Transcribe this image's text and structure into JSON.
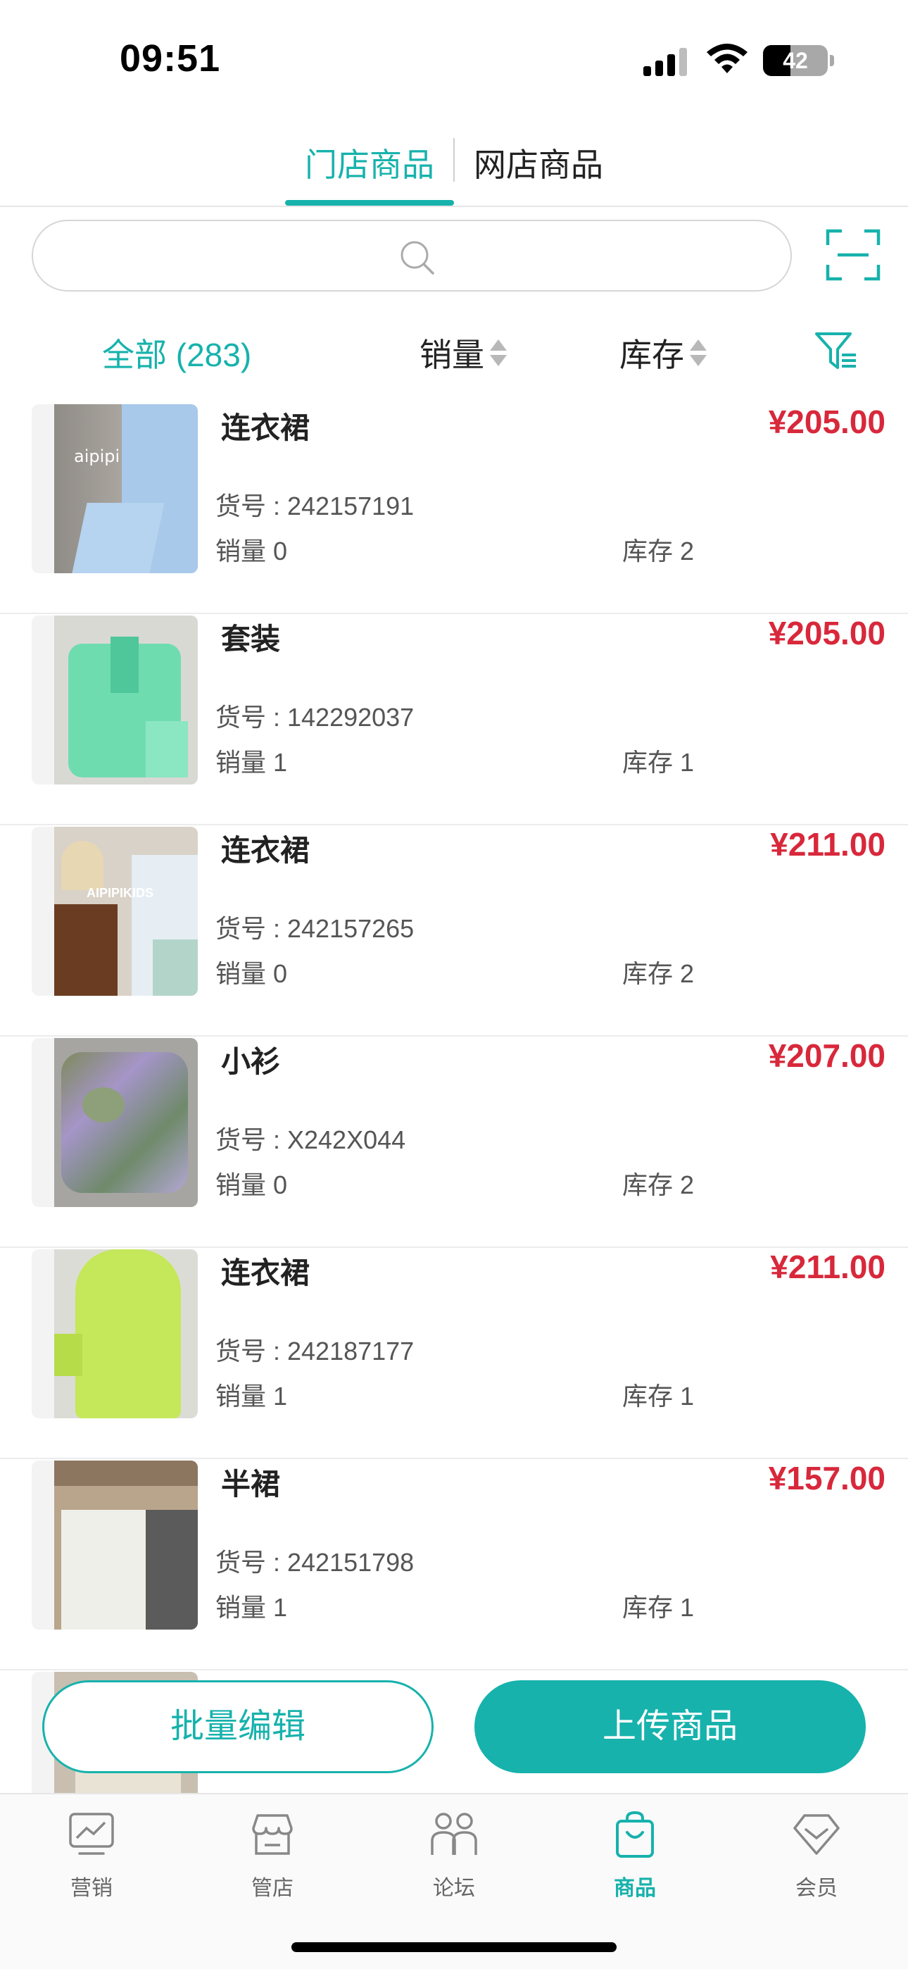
{
  "status_bar": {
    "time": "09:51",
    "battery": "42",
    "battery_level": 0.42
  },
  "tabs": [
    {
      "label": "门店商品",
      "active": true
    },
    {
      "label": "网店商品",
      "active": false
    }
  ],
  "search": {
    "placeholder": ""
  },
  "filter": {
    "all_label": "全部 (283)",
    "sales_label": "销量",
    "stock_label": "库存"
  },
  "products": [
    {
      "name": "连衣裙",
      "price": "¥205.00",
      "sku": "货号 : 242157191",
      "sales": "销量 0",
      "stock": "库存 2"
    },
    {
      "name": "套装",
      "price": "¥205.00",
      "sku": "货号 : 142292037",
      "sales": "销量 1",
      "stock": "库存 1"
    },
    {
      "name": "连衣裙",
      "price": "¥211.00",
      "sku": "货号 : 242157265",
      "sales": "销量 0",
      "stock": "库存 2"
    },
    {
      "name": "小衫",
      "price": "¥207.00",
      "sku": "货号 : X242X044",
      "sales": "销量 0",
      "stock": "库存 2"
    },
    {
      "name": "连衣裙",
      "price": "¥211.00",
      "sku": "货号 : 242187177",
      "sales": "销量 1",
      "stock": "库存 1"
    },
    {
      "name": "半裙",
      "price": "¥157.00",
      "sku": "货号 : 242151798",
      "sales": "销量 1",
      "stock": "库存 1"
    },
    {
      "name": "",
      "price": "",
      "sku": "",
      "sales": "",
      "stock": ""
    }
  ],
  "actions": {
    "batch_edit": "批量编辑",
    "upload": "上传商品"
  },
  "nav": [
    {
      "label": "营销",
      "icon": "chart-icon"
    },
    {
      "label": "管店",
      "icon": "store-icon"
    },
    {
      "label": "论坛",
      "icon": "people-icon"
    },
    {
      "label": "商品",
      "icon": "bag-icon",
      "active": true
    },
    {
      "label": "会员",
      "icon": "diamond-icon"
    }
  ],
  "colors": {
    "accent": "#17b2ac",
    "price": "#d8283b"
  }
}
